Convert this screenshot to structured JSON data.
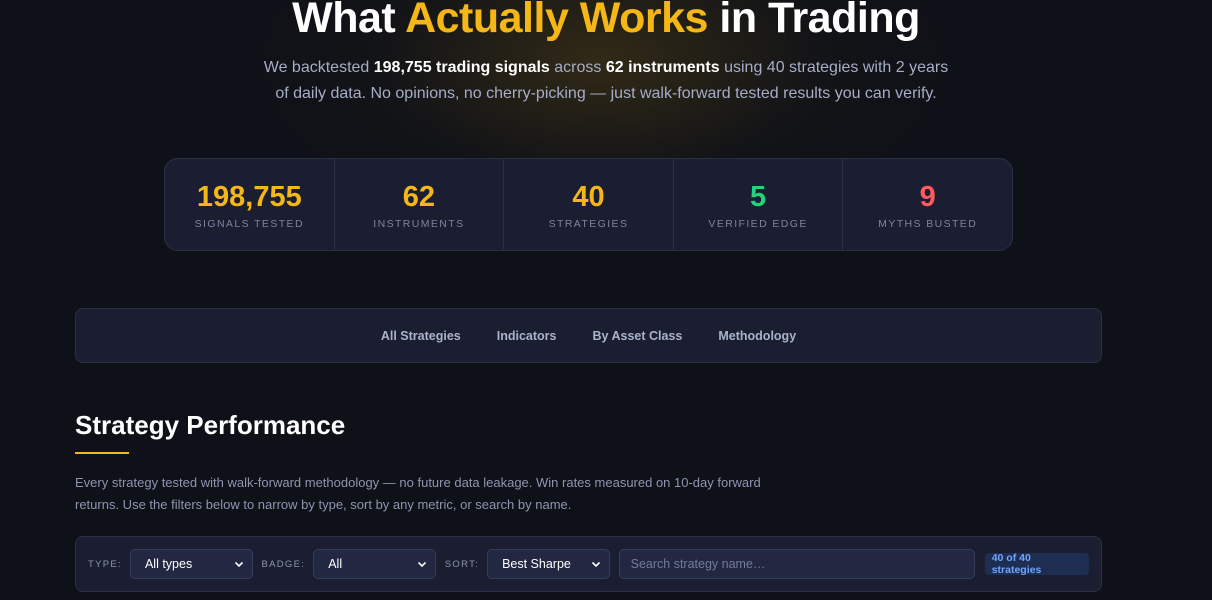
{
  "hero": {
    "title_before": "What ",
    "title_accent": "Actually Works",
    "title_after": " in Trading",
    "sub_1": "We backtested ",
    "sub_signals": "198,755 trading signals",
    "sub_2": " across ",
    "sub_instruments": "62 instruments",
    "sub_3": " using 40 strategies with 2 years of daily data. No opinions, no cherry-picking — just walk-forward tested results you can verify."
  },
  "stats": [
    {
      "value": "198,755",
      "label": "SIGNALS TESTED",
      "color": "#f5b718"
    },
    {
      "value": "62",
      "label": "INSTRUMENTS",
      "color": "#f5b718"
    },
    {
      "value": "40",
      "label": "STRATEGIES",
      "color": "#f5b718"
    },
    {
      "value": "5",
      "label": "VERIFIED EDGE",
      "color": "#22d37a"
    },
    {
      "value": "9",
      "label": "MYTHS BUSTED",
      "color": "#ff5a5f"
    }
  ],
  "tabs": [
    {
      "label": "All Strategies"
    },
    {
      "label": "Indicators"
    },
    {
      "label": "By Asset Class"
    },
    {
      "label": "Methodology"
    }
  ],
  "section": {
    "title": "Strategy Performance",
    "description": "Every strategy tested with walk-forward methodology — no future data leakage. Win rates measured on 10-day forward returns. Use the filters below to narrow by type, sort by any metric, or search by name."
  },
  "filters": {
    "type_label": "TYPE:",
    "type_value": "All types",
    "badge_label": "BADGE:",
    "badge_value": "All",
    "sort_label": "SORT:",
    "sort_value": "Best Sharpe",
    "search_placeholder": "Search strategy name…",
    "count": "40 of 40 strategies"
  },
  "colors": {
    "accent": "#f5b718",
    "verified": "#22d37a",
    "myths": "#ff5a5f",
    "badge_text": "#6ea6ff"
  }
}
